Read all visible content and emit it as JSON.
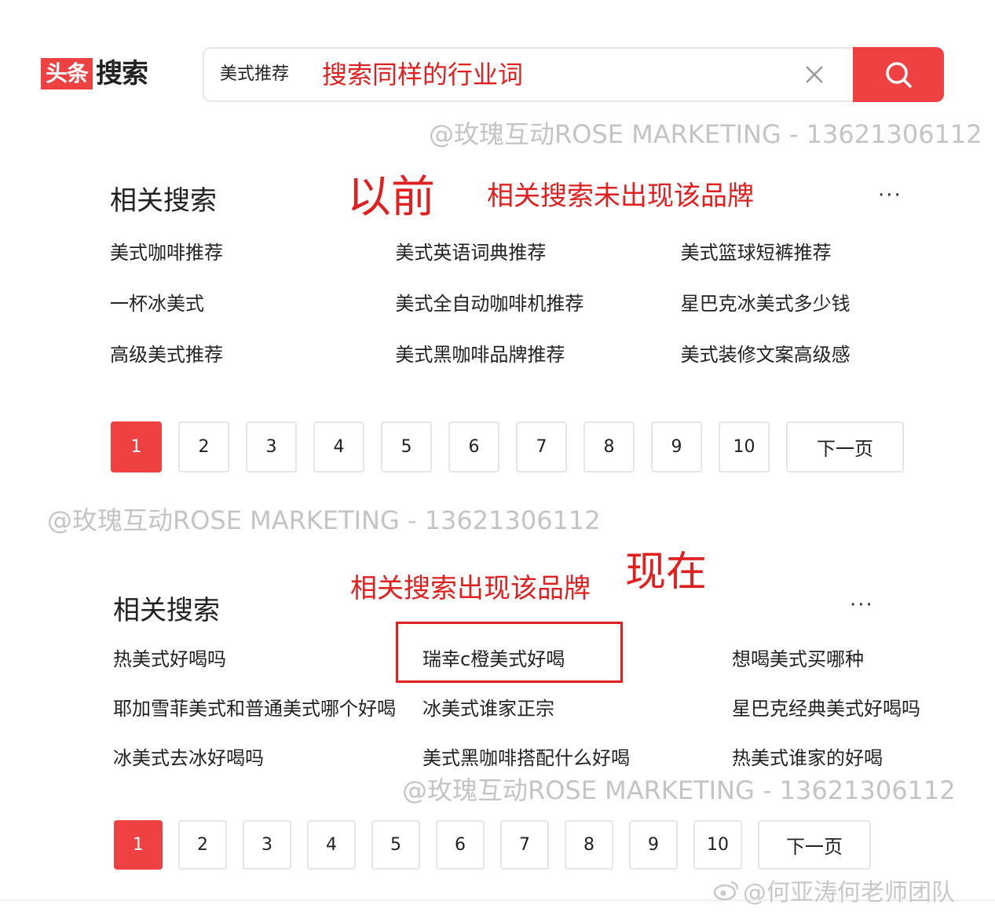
{
  "header": {
    "logo_box": "头条",
    "logo_text": "搜索",
    "search_query": "美式推荐",
    "search_annotation": "搜索同样的行业词"
  },
  "watermarks": {
    "text": "@玫瑰互动ROSE MARKETING - 13621306112"
  },
  "section_before": {
    "title": "相关搜索",
    "label": "以前",
    "annotation": "相关搜索未出现该品牌",
    "more": "···",
    "items": [
      "美式咖啡推荐",
      "美式英语词典推荐",
      "美式篮球短裤推荐",
      "一杯冰美式",
      "美式全自动咖啡机推荐",
      "星巴克冰美式多少钱",
      "高级美式推荐",
      "美式黑咖啡品牌推荐",
      "美式装修文案高级感"
    ]
  },
  "section_after": {
    "title": "相关搜索",
    "label": "现在",
    "annotation": "相关搜索出现该品牌",
    "more": "···",
    "items": [
      "热美式好喝吗",
      "瑞幸c橙美式好喝",
      "想喝美式买哪种",
      "耶加雪菲美式和普通美式哪个好喝",
      "冰美式谁家正宗",
      "星巴克经典美式好喝吗",
      "冰美式去冰好喝吗",
      "美式黑咖啡搭配什么好喝",
      "热美式谁家的好喝"
    ]
  },
  "pagination": {
    "pages": [
      "1",
      "2",
      "3",
      "4",
      "5",
      "6",
      "7",
      "8",
      "9",
      "10"
    ],
    "active": "1",
    "next_label": "下一页"
  },
  "footer": {
    "credit": "@何亚涛何老师团队"
  },
  "colors": {
    "brand": "#f04142",
    "annotation": "#e02020"
  },
  "icons": {
    "clear": "close-icon",
    "search": "search-icon",
    "credit": "weibo-icon"
  }
}
